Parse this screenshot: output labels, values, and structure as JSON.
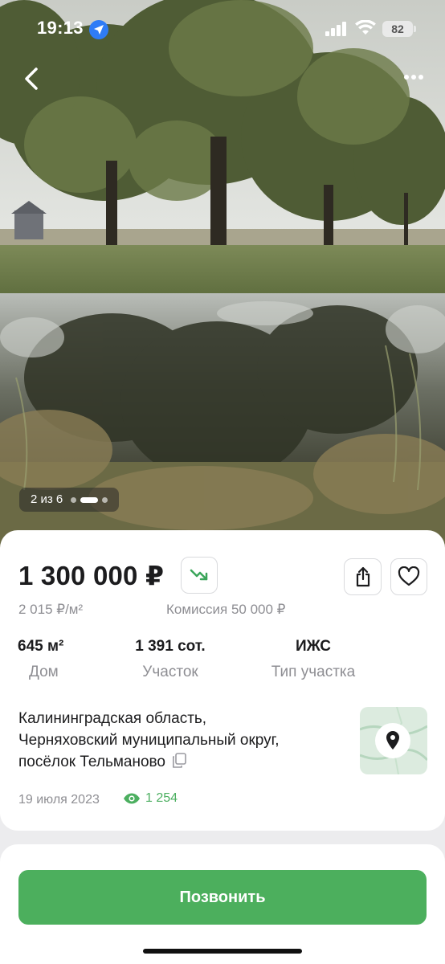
{
  "status_bar": {
    "time": "19:13",
    "battery": "82",
    "icons": [
      "location-arrow-icon",
      "signal-icon",
      "wifi-icon",
      "battery-icon"
    ]
  },
  "gallery": {
    "counter": "2 из 6",
    "current_index": 2,
    "total": 6
  },
  "listing": {
    "price": "1 300 000 ₽",
    "price_per_m2": "2 015 ₽/м²",
    "commission": "Комиссия 50 000 ₽",
    "stats": [
      {
        "value": "645 м²",
        "label": "Дом"
      },
      {
        "value": "1 391 сот.",
        "label": "Участок"
      },
      {
        "value": "ИЖС",
        "label": "Тип участка"
      }
    ],
    "address": {
      "line1": "Калининградская область,",
      "line2": "Черняховский муниципальный округ,",
      "line3": "посёлок Тельманово"
    },
    "date": "19 июля 2023",
    "views": "1 254"
  },
  "actions": {
    "call_label": "Позвонить"
  },
  "colors": {
    "accent_green": "#4caf5d",
    "muted_text": "#8e8e93",
    "trend_down": "#3aa55a"
  }
}
